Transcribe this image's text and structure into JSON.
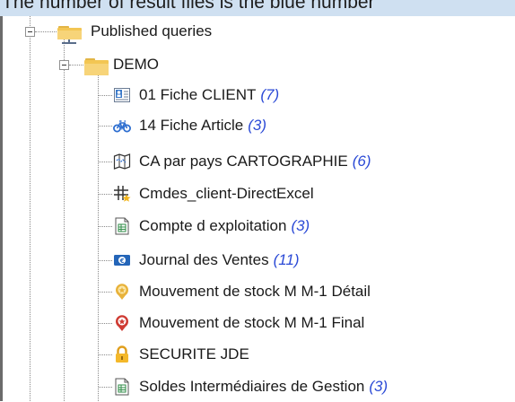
{
  "header_caption": "The number of result files is the blue number",
  "tree": {
    "root": {
      "label": "Published queries",
      "icon": "published-folder-icon"
    },
    "folder": {
      "label": "DEMO",
      "icon": "folder-open-icon"
    },
    "items": [
      {
        "label": "01 Fiche CLIENT",
        "count": "(7)",
        "icon": "client-card-icon"
      },
      {
        "label": "14 Fiche Article",
        "count": "(3)",
        "icon": "bicycle-icon"
      },
      {
        "label": "CA par pays CARTOGRAPHIE",
        "count": "(6)",
        "icon": "map-icon"
      },
      {
        "label": "Cmdes_client-DirectExcel",
        "count": "",
        "icon": "grid-star-icon"
      },
      {
        "label": "Compte d exploitation",
        "count": "(3)",
        "icon": "spreadsheet-document-icon"
      },
      {
        "label": "Journal des Ventes",
        "count": "(11)",
        "icon": "euro-card-icon"
      },
      {
        "label": "Mouvement de stock M M-1 Détail",
        "count": "",
        "icon": "yellow-badge-icon"
      },
      {
        "label": "Mouvement de stock M M-1 Final",
        "count": "",
        "icon": "red-badge-icon"
      },
      {
        "label": "SECURITE JDE",
        "count": "",
        "icon": "padlock-icon"
      },
      {
        "label": "Soldes Intermédiaires de Gestion",
        "count": "(3)",
        "icon": "spreadsheet-document-icon"
      }
    ]
  },
  "colors": {
    "count_blue": "#2b4ad6",
    "folder_yellow": "#f3c653",
    "header_band": "#cfe0f1"
  }
}
